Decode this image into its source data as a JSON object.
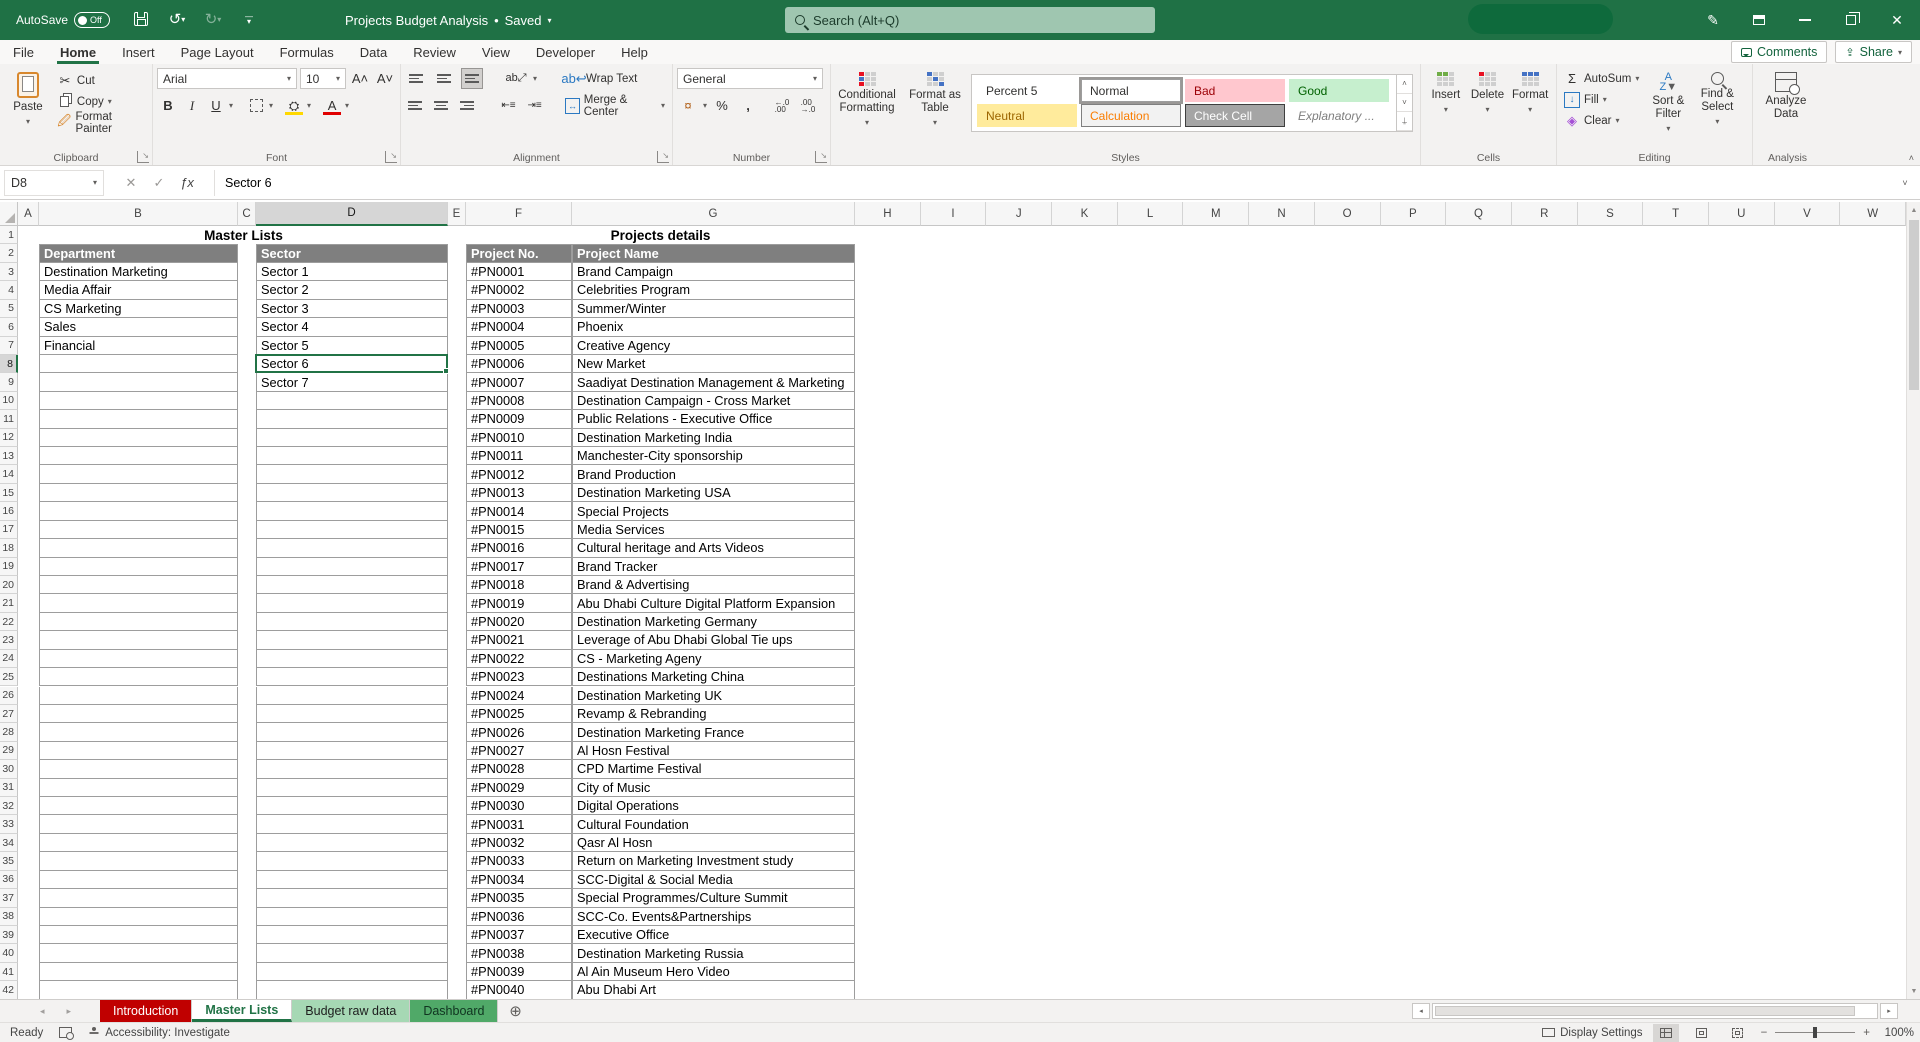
{
  "titlebar": {
    "autosave_label": "AutoSave",
    "autosave_state": "Off",
    "title": "Projects Budget Analysis",
    "saved_label": "Saved",
    "search_placeholder": "Search (Alt+Q)"
  },
  "menu": {
    "tabs": [
      "File",
      "Home",
      "Insert",
      "Page Layout",
      "Formulas",
      "Data",
      "Review",
      "View",
      "Developer",
      "Help"
    ],
    "active_tab": "Home",
    "comments_label": "Comments",
    "share_label": "Share"
  },
  "ribbon": {
    "clipboard": {
      "label": "Clipboard",
      "paste": "Paste",
      "cut": "Cut",
      "copy": "Copy",
      "format_painter": "Format Painter"
    },
    "font": {
      "label": "Font",
      "family": "Arial",
      "size": "10"
    },
    "alignment": {
      "label": "Alignment",
      "wrap_text": "Wrap Text",
      "merge_center": "Merge & Center"
    },
    "number": {
      "label": "Number",
      "format": "General"
    },
    "styles": {
      "label": "Styles",
      "conditional": "Conditional Formatting",
      "format_table": "Format as Table",
      "gallery": [
        {
          "name": "Percent 5",
          "bg": "transparent",
          "fg": "#323130",
          "border": "transparent",
          "italic": false,
          "selected": false
        },
        {
          "name": "Normal",
          "bg": "#ffffff",
          "fg": "#323130",
          "border": "#9d9d9d",
          "italic": false,
          "selected": true
        },
        {
          "name": "Bad",
          "bg": "#ffc7ce",
          "fg": "#9c0006",
          "border": "transparent",
          "italic": false,
          "selected": false
        },
        {
          "name": "Good",
          "bg": "#c6efce",
          "fg": "#006100",
          "border": "transparent",
          "italic": false,
          "selected": false
        },
        {
          "name": "Neutral",
          "bg": "#ffeb9c",
          "fg": "#9c6500",
          "border": "transparent",
          "italic": false,
          "selected": false
        },
        {
          "name": "Calculation",
          "bg": "#f2f2f2",
          "fg": "#fa7d00",
          "border": "#7f7f7f",
          "italic": false,
          "selected": false
        },
        {
          "name": "Check Cell",
          "bg": "#a5a5a5",
          "fg": "#ffffff",
          "border": "#3f3f3f",
          "italic": false,
          "selected": false
        },
        {
          "name": "Explanatory ...",
          "bg": "transparent",
          "fg": "#7f7f7f",
          "border": "transparent",
          "italic": true,
          "selected": false
        }
      ]
    },
    "cells": {
      "label": "Cells",
      "insert": "Insert",
      "delete": "Delete",
      "format": "Format"
    },
    "editing": {
      "label": "Editing",
      "autosum": "AutoSum",
      "fill": "Fill",
      "clear": "Clear",
      "sort_filter": "Sort & Filter",
      "find_select": "Find & Select"
    },
    "analysis": {
      "label": "Analysis",
      "analyze": "Analyze Data"
    }
  },
  "formula_bar": {
    "name_box": "D8",
    "formula": "Sector 6"
  },
  "grid": {
    "column_letters": [
      "A",
      "B",
      "C",
      "D",
      "E",
      "F",
      "G",
      "H",
      "I",
      "J",
      "K",
      "L",
      "M",
      "N",
      "O",
      "P",
      "Q",
      "R",
      "S",
      "T",
      "U",
      "V",
      "W"
    ],
    "selected_column": "D",
    "selected_row": 8,
    "row_count": 42,
    "titles": {
      "master": "Master Lists",
      "projects": "Projects details"
    },
    "headers": {
      "department": "Department",
      "sector": "Sector",
      "project_no": "Project No.",
      "project_name": "Project Name"
    },
    "departments": [
      "Destination Marketing",
      "Media Affair",
      "CS Marketing",
      "Sales",
      "Financial"
    ],
    "sectors": [
      "Sector 1",
      "Sector 2",
      "Sector 3",
      "Sector 4",
      "Sector 5",
      "Sector 6",
      "Sector 7"
    ],
    "projects": [
      {
        "no": "#PN0001",
        "name": "Brand Campaign"
      },
      {
        "no": "#PN0002",
        "name": "Celebrities Program"
      },
      {
        "no": "#PN0003",
        "name": "Summer/Winter"
      },
      {
        "no": "#PN0004",
        "name": "Phoenix"
      },
      {
        "no": "#PN0005",
        "name": "Creative Agency"
      },
      {
        "no": "#PN0006",
        "name": "New Market"
      },
      {
        "no": "#PN0007",
        "name": "Saadiyat Destination Management & Marketing"
      },
      {
        "no": "#PN0008",
        "name": "Destination Campaign - Cross Market"
      },
      {
        "no": "#PN0009",
        "name": "Public Relations - Executive Office"
      },
      {
        "no": "#PN0010",
        "name": "Destination Marketing India"
      },
      {
        "no": "#PN0011",
        "name": "Manchester-City sponsorship"
      },
      {
        "no": "#PN0012",
        "name": "Brand Production"
      },
      {
        "no": "#PN0013",
        "name": "Destination Marketing USA"
      },
      {
        "no": "#PN0014",
        "name": "Special Projects"
      },
      {
        "no": "#PN0015",
        "name": "Media Services"
      },
      {
        "no": "#PN0016",
        "name": "Cultural heritage and Arts Videos"
      },
      {
        "no": "#PN0017",
        "name": "Brand Tracker"
      },
      {
        "no": "#PN0018",
        "name": "Brand & Advertising"
      },
      {
        "no": "#PN0019",
        "name": "Abu Dhabi Culture Digital Platform Expansion"
      },
      {
        "no": "#PN0020",
        "name": "Destination Marketing Germany"
      },
      {
        "no": "#PN0021",
        "name": "Leverage of Abu Dhabi Global Tie ups"
      },
      {
        "no": "#PN0022",
        "name": "CS - Marketing Ageny"
      },
      {
        "no": "#PN0023",
        "name": "Destinations Marketing China"
      },
      {
        "no": "#PN0024",
        "name": "Destination Marketing UK"
      },
      {
        "no": "#PN0025",
        "name": "Revamp & Rebranding"
      },
      {
        "no": "#PN0026",
        "name": "Destination Marketing France"
      },
      {
        "no": "#PN0027",
        "name": "Al Hosn Festival"
      },
      {
        "no": "#PN0028",
        "name": "CPD Martime Festival"
      },
      {
        "no": "#PN0029",
        "name": "City of Music"
      },
      {
        "no": "#PN0030",
        "name": "Digital Operations"
      },
      {
        "no": "#PN0031",
        "name": "Cultural Foundation"
      },
      {
        "no": "#PN0032",
        "name": "Qasr Al Hosn"
      },
      {
        "no": "#PN0033",
        "name": "Return on Marketing Investment study"
      },
      {
        "no": "#PN0034",
        "name": "SCC-Digital & Social Media"
      },
      {
        "no": "#PN0035",
        "name": "Special Programmes/Culture Summit"
      },
      {
        "no": "#PN0036",
        "name": "SCC-Co. Events&Partnerships"
      },
      {
        "no": "#PN0037",
        "name": "Executive Office"
      },
      {
        "no": "#PN0038",
        "name": "Destination Marketing Russia"
      },
      {
        "no": "#PN0039",
        "name": "Al Ain Museum Hero Video"
      },
      {
        "no": "#PN0040",
        "name": "Abu Dhabi Art"
      }
    ]
  },
  "sheet_tabs": {
    "tabs": [
      {
        "name": "Introduction",
        "bg": "#c00000",
        "fg": "#ffffff",
        "active": false
      },
      {
        "name": "Master Lists",
        "bg": "#ffffff",
        "fg": "#217346",
        "active": true
      },
      {
        "name": "Budget raw data",
        "bg": "#a6d8b4",
        "fg": "#1e1e1e",
        "active": false
      },
      {
        "name": "Dashboard",
        "bg": "#50a968",
        "fg": "#103420",
        "active": false
      }
    ]
  },
  "status_bar": {
    "ready": "Ready",
    "accessibility": "Accessibility: Investigate",
    "display_settings": "Display Settings",
    "zoom": "100%"
  },
  "colors": {
    "accent": "#217346",
    "titlebar": "#1f7145",
    "table_header": "#7f7f7f",
    "tab_red": "#c00000"
  }
}
